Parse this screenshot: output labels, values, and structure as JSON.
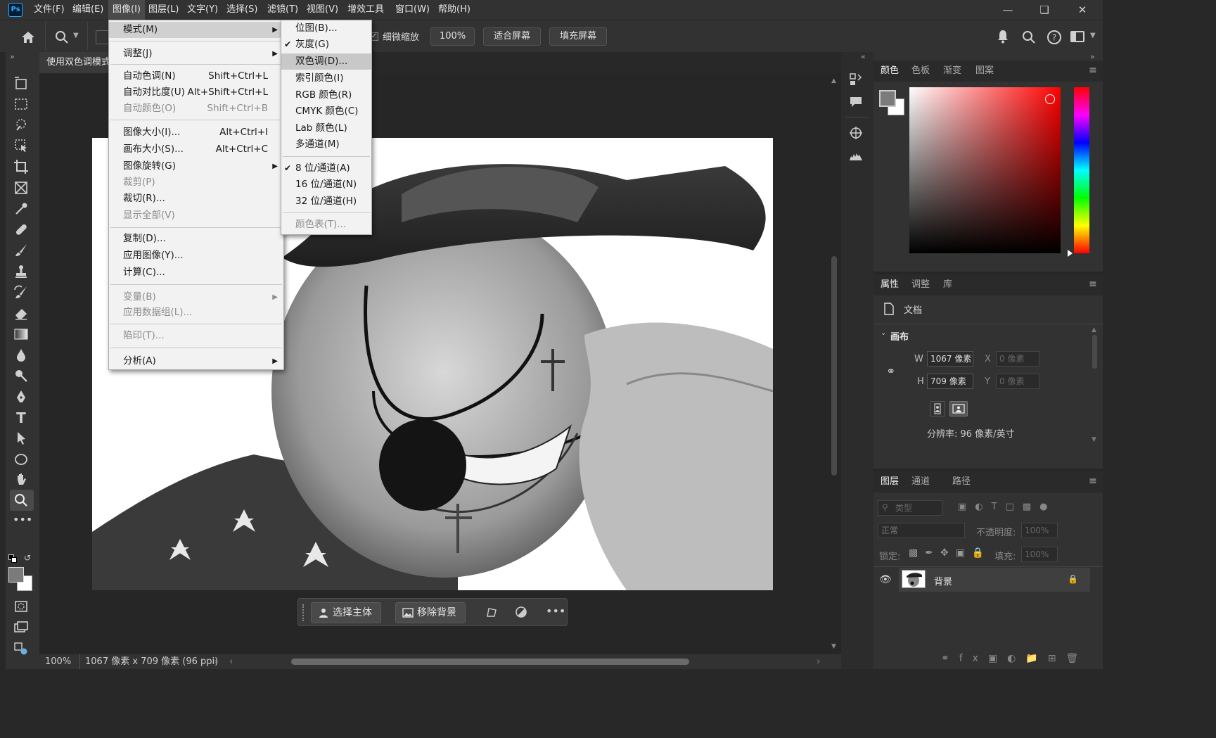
{
  "app": {
    "logo": "Ps"
  },
  "menubar": {
    "items": [
      "文件(F)",
      "编辑(E)",
      "图像(I)",
      "图层(L)",
      "文字(Y)",
      "选择(S)",
      "滤镜(T)",
      "视图(V)",
      "增效工具",
      "窗口(W)",
      "帮助(H)"
    ],
    "active": "图像(I)"
  },
  "options": {
    "scrubby_zoom": "细微缩放",
    "zoom_value": "100%",
    "fit_screen": "适合屏幕",
    "fill_screen": "填充屏幕"
  },
  "doc_tab": {
    "title": "使用双色调模式"
  },
  "status": {
    "zoom": "100%",
    "info": "1067 像素 x 709 像素 (96 ppi)"
  },
  "image_menu": {
    "items": [
      {
        "label": "模式(M)",
        "shortcut": "",
        "submenu": true,
        "disabled": false,
        "highlight": true
      },
      {
        "label": "调整(J)",
        "shortcut": "",
        "submenu": true,
        "disabled": false
      },
      {
        "label": "自动色调(N)",
        "shortcut": "Shift+Ctrl+L",
        "disabled": false
      },
      {
        "label": "自动对比度(U)",
        "shortcut": "Alt+Shift+Ctrl+L",
        "disabled": false
      },
      {
        "label": "自动颜色(O)",
        "shortcut": "Shift+Ctrl+B",
        "disabled": true
      },
      {
        "label": "图像大小(I)...",
        "shortcut": "Alt+Ctrl+I",
        "disabled": false
      },
      {
        "label": "画布大小(S)...",
        "shortcut": "Alt+Ctrl+C",
        "disabled": false
      },
      {
        "label": "图像旋转(G)",
        "shortcut": "",
        "submenu": true,
        "disabled": false
      },
      {
        "label": "裁剪(P)",
        "shortcut": "",
        "disabled": true
      },
      {
        "label": "裁切(R)...",
        "shortcut": "",
        "disabled": false
      },
      {
        "label": "显示全部(V)",
        "shortcut": "",
        "disabled": true
      },
      {
        "label": "复制(D)...",
        "shortcut": "",
        "disabled": false
      },
      {
        "label": "应用图像(Y)...",
        "shortcut": "",
        "disabled": false
      },
      {
        "label": "计算(C)...",
        "shortcut": "",
        "disabled": false
      },
      {
        "label": "变量(B)",
        "shortcut": "",
        "submenu": true,
        "disabled": true
      },
      {
        "label": "应用数据组(L)...",
        "shortcut": "",
        "disabled": true
      },
      {
        "label": "陷印(T)...",
        "shortcut": "",
        "disabled": true
      },
      {
        "label": "分析(A)",
        "shortcut": "",
        "submenu": true,
        "disabled": false
      }
    ]
  },
  "mode_menu": {
    "items": [
      {
        "label": "位图(B)...",
        "checked": false,
        "disabled": false
      },
      {
        "label": "灰度(G)",
        "checked": true,
        "disabled": false
      },
      {
        "label": "双色调(D)...",
        "checked": false,
        "disabled": false,
        "highlight": true
      },
      {
        "label": "索引颜色(I)",
        "checked": false,
        "disabled": false
      },
      {
        "label": "RGB 颜色(R)",
        "checked": false,
        "disabled": false
      },
      {
        "label": "CMYK 颜色(C)",
        "checked": false,
        "disabled": false
      },
      {
        "label": "Lab 颜色(L)",
        "checked": false,
        "disabled": false
      },
      {
        "label": "多通道(M)",
        "checked": false,
        "disabled": false
      },
      {
        "label": "8 位/通道(A)",
        "checked": true,
        "disabled": false
      },
      {
        "label": "16 位/通道(N)",
        "checked": false,
        "disabled": false
      },
      {
        "label": "32 位/通道(H)",
        "checked": false,
        "disabled": false
      },
      {
        "label": "颜色表(T)...",
        "checked": false,
        "disabled": true
      }
    ]
  },
  "color_panel": {
    "tabs": [
      "颜色",
      "色板",
      "渐变",
      "图案"
    ]
  },
  "properties_panel": {
    "tabs": [
      "属性",
      "调整",
      "库"
    ],
    "doc_label": "文档",
    "section": "画布",
    "w_label": "W",
    "w_value": "1067 像素",
    "h_label": "H",
    "h_value": "709 像素",
    "x_label": "X",
    "x_value": "0 像素",
    "y_label": "Y",
    "y_value": "0 像素",
    "resolution": "分辨率: 96 像素/英寸"
  },
  "layers_panel": {
    "tabs": [
      "图层",
      "通道",
      "路径"
    ],
    "filter_placeholder": "类型",
    "blend_mode": "正常",
    "opacity_label": "不透明度:",
    "opacity_value": "100%",
    "lock_label": "锁定:",
    "fill_label": "填充:",
    "fill_value": "100%",
    "layers": [
      {
        "name": "背景",
        "visible": true,
        "locked": true
      }
    ]
  },
  "context_bar": {
    "select_subject": "选择主体",
    "remove_bg": "移除背景"
  },
  "colors": {
    "highlight": "#d0d0d0",
    "menu_bg": "#f2f2f2",
    "panel": "#323232",
    "accent_red": "#ff0000"
  }
}
